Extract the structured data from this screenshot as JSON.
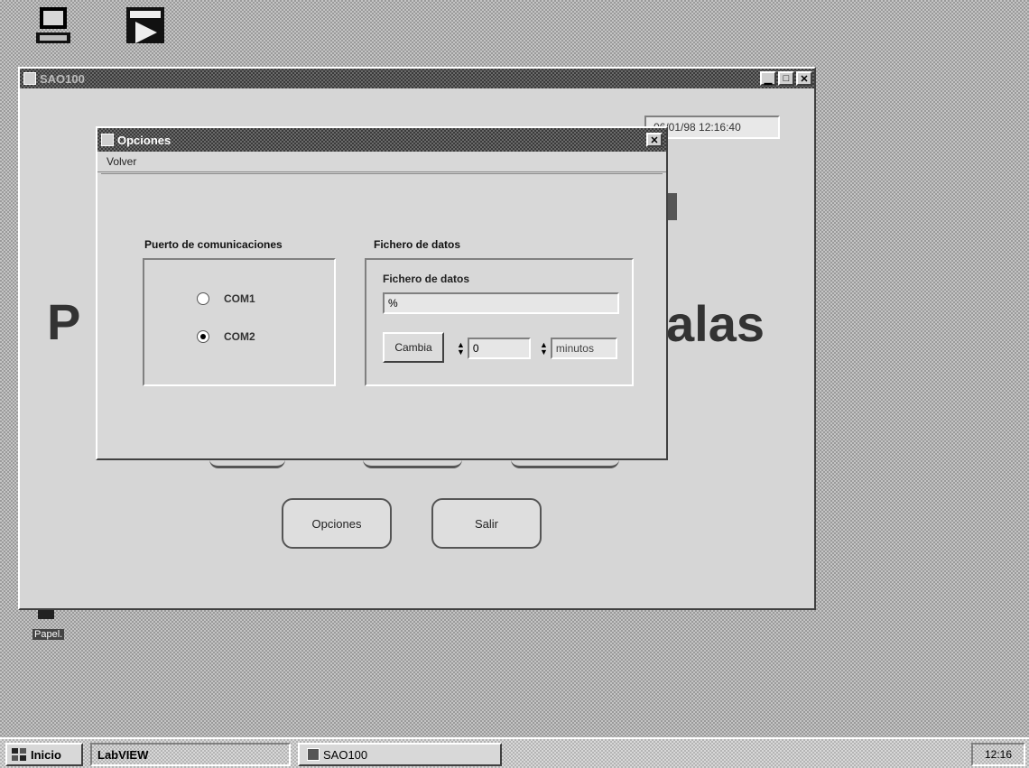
{
  "desktop": {
    "icons": [
      {
        "label": "",
        "icon": "my-computer-icon"
      },
      {
        "label": "",
        "icon": "labview-shortcut-icon"
      }
    ],
    "recycle_label": "Papel."
  },
  "main_window": {
    "title": "SAO100",
    "datetime": "06/01/98 12:16:40",
    "heading_left": "P",
    "heading_right": "alas",
    "buttons": {
      "options": "Opciones",
      "exit": "Salir"
    }
  },
  "dialog": {
    "title": "Opciones",
    "menu_return": "Volver",
    "port_group": {
      "title": "Puerto de comunicaciones",
      "options": [
        {
          "label": "COM1",
          "selected": false
        },
        {
          "label": "COM2",
          "selected": true
        }
      ]
    },
    "file_group": {
      "title": "Fichero de datos",
      "field_label": "Fichero de datos",
      "path_value": "%",
      "change_button": "Cambia",
      "interval_value": "0",
      "units_value": "minutos"
    }
  },
  "taskbar": {
    "start_label": "Inicio",
    "tasks": [
      "LabVIEW",
      "SAO100"
    ],
    "clock": "12:16"
  },
  "colors": {
    "titlebar_active": "#000000",
    "window_face": "#d6d6d6"
  }
}
